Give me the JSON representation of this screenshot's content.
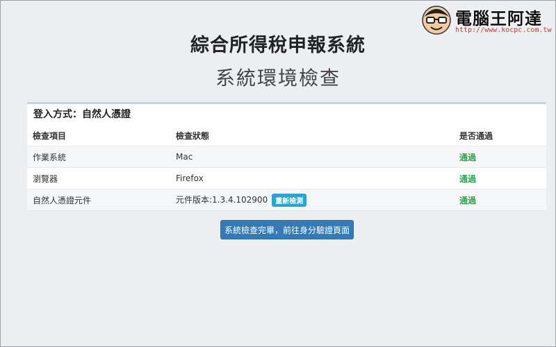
{
  "logo": {
    "name": "電腦王阿達",
    "url": "http://www.kocpc.com.tw"
  },
  "header": {
    "title": "綜合所得稅申報系統",
    "subtitle": "系統環境檢查"
  },
  "panel": {
    "heading": "登入方式：自然人憑證",
    "columns": [
      "檢查項目",
      "檢查狀態",
      "是否通過"
    ],
    "rows": [
      {
        "item": "作業系統",
        "status": "Mac",
        "result": "通過"
      },
      {
        "item": "瀏覽器",
        "status": "Firefox",
        "result": "通過"
      },
      {
        "item": "自然人憑證元件",
        "status": "元件版本:1.3.4.102900",
        "action": "重新檢測",
        "result": "通過"
      }
    ]
  },
  "submit_label": "系統檢查完畢，前往身分驗證頁面",
  "colors": {
    "pass": "#2ea44f",
    "primary_button": "#337ab7",
    "badge": "#20a8d8"
  }
}
